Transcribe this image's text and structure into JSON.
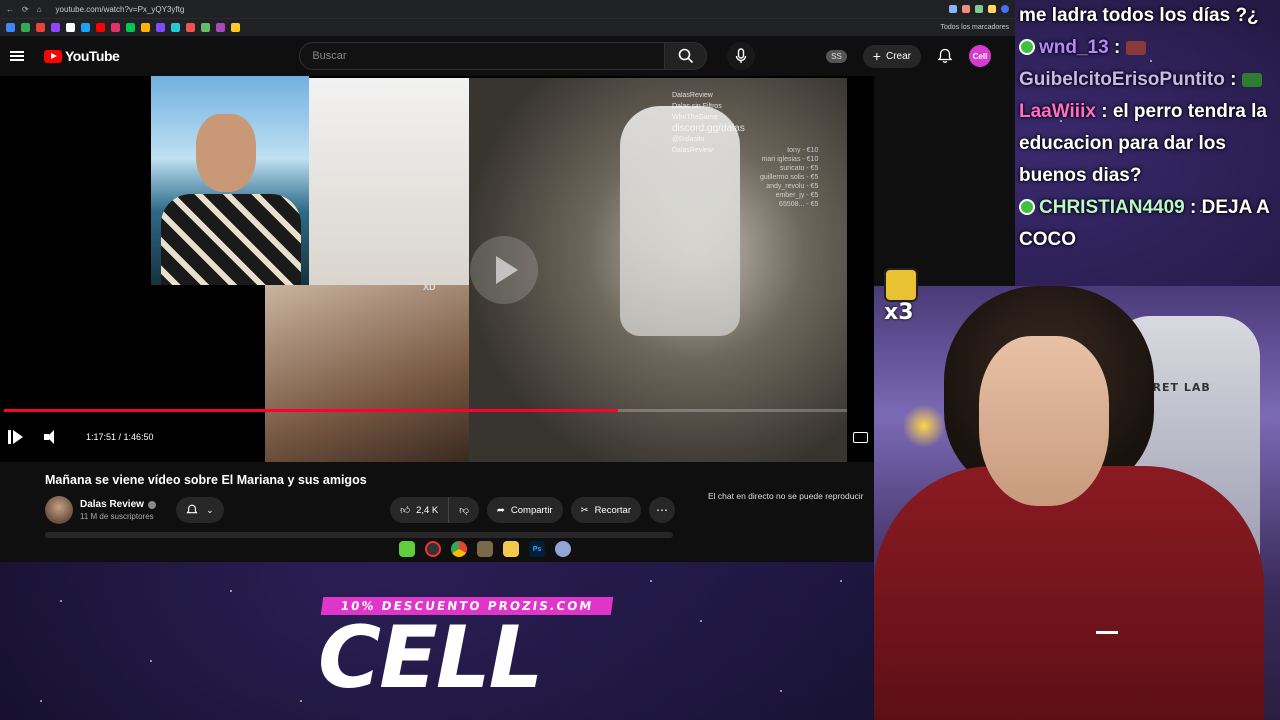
{
  "browser": {
    "url": "youtube.com/watch?v=Px_yQY3yftg",
    "bookmarks_label": "Todos los marcadores"
  },
  "youtube": {
    "logo_text": "YouTube",
    "search_placeholder": "Buscar",
    "ss_badge": "SS",
    "create_label": "Crear",
    "avatar_text": "Cell"
  },
  "player": {
    "time": "1:17:51 / 1:46:50",
    "progress_fraction": 0.728,
    "overlay_xd": "XD",
    "overlay_social": [
      "DalasReview",
      "Dalas sin Filtros",
      "WhoTheGame",
      "discord.gg/dalas",
      "@Dalasito",
      "DalasReview"
    ],
    "overlay_names": [
      "tony - €10",
      "mari iglesias - €10",
      "suricato - €5",
      "guillermo solis - €5",
      "andy_revolu - €5",
      "ember_jy - €5",
      "65508... - €5"
    ]
  },
  "video": {
    "title": "Mañana se viene vídeo sobre El Mariana y sus amigos",
    "channel_name": "Dalas Review",
    "subscribers": "11 M de suscriptores",
    "likes": "2,4 K",
    "share_label": "Compartir",
    "clip_label": "Recortar",
    "chat_note": "El chat en directo no se puede reproducir"
  },
  "chat": {
    "messages": [
      {
        "user": "",
        "text": "me ladra todos los días ?¿",
        "color": "#ffffff"
      },
      {
        "user": "wnd_13",
        "text": "",
        "color": "#b388ff",
        "badge": true,
        "emote": "#8b3a3a"
      },
      {
        "user": "GuibelcitoErisoPuntito",
        "text": "",
        "color": "#c9b8e8",
        "emote": "#2e7d32"
      },
      {
        "user": "LaaWiiix",
        "text": "el perro tendra la educacion para dar los buenos dias?",
        "color": "#ff6ec7"
      },
      {
        "user": "CHRISTIAN4409",
        "text": "DEJA A COCO",
        "color": "#b9f6ca",
        "badge": true
      }
    ]
  },
  "stream": {
    "emote_count": "x3",
    "chair_text": "SECRET LAB"
  },
  "promo": {
    "tag": "10% DESCUENTO PROZIS.COM",
    "title": "CELL"
  }
}
